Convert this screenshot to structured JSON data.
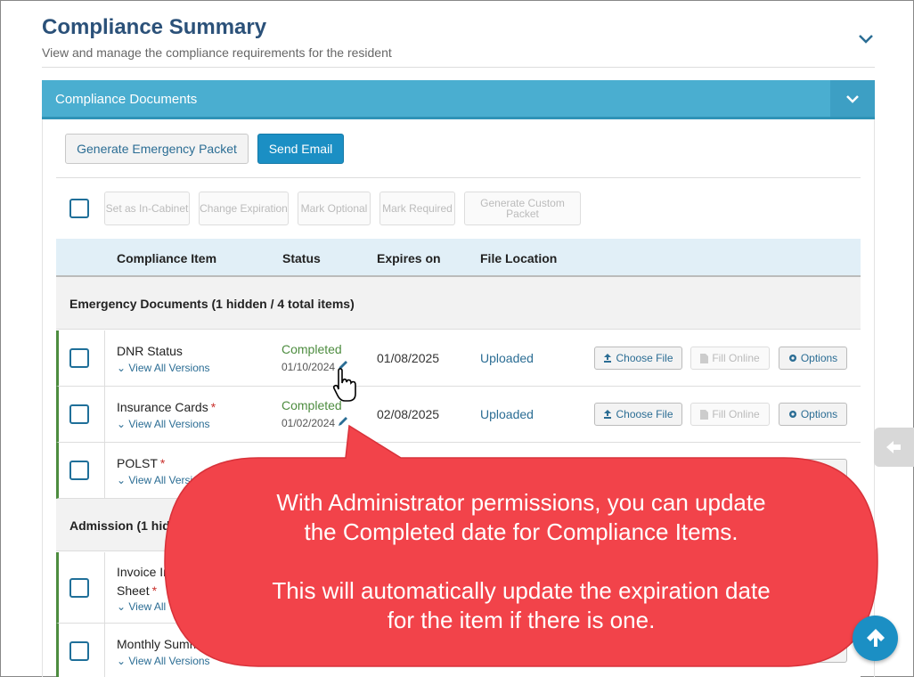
{
  "header": {
    "title": "Compliance Summary",
    "subtitle": "View and manage the compliance requirements for the resident"
  },
  "panel": {
    "title": "Compliance Documents"
  },
  "actions": {
    "generate_emergency_packet": "Generate Emergency Packet",
    "send_email": "Send Email"
  },
  "bulk_actions": {
    "set_in_cabinet": "Set as In-Cabinet",
    "change_expiration": "Change Expiration",
    "mark_optional": "Mark Optional",
    "mark_required": "Mark Required",
    "generate_custom_packet": "Generate Custom Packet"
  },
  "table": {
    "columns": [
      "Compliance Item",
      "Status",
      "Expires on",
      "File Location"
    ]
  },
  "groups": [
    {
      "label": "Emergency Documents (1 hidden / 4 total items)"
    },
    {
      "label": "Admission (1 hidden"
    }
  ],
  "rows": [
    {
      "name": "DNR Status",
      "required": "",
      "versions": "View All Versions",
      "status": "Completed",
      "status_date": "01/10/2024",
      "expires": "01/08/2025",
      "file_location": "Uploaded"
    },
    {
      "name": "Insurance Cards",
      "required": "*",
      "versions": "View All Versions",
      "status": "Completed",
      "status_date": "01/02/2024",
      "expires": "02/08/2025",
      "file_location": "Uploaded"
    },
    {
      "name": "POLST",
      "required": "*",
      "versions": "View All Versions"
    },
    {
      "name_line1": "Invoice In",
      "name_line2": "Sheet",
      "required": "*",
      "versions": "View All Versions"
    },
    {
      "name": "Monthly Summa",
      "versions": "View All Versions"
    }
  ],
  "row_buttons": {
    "choose_file": "Choose File",
    "fill_online": "Fill Online",
    "options": "Options",
    "options_partial": "tions"
  },
  "callout": {
    "line1": "With Administrator permissions, you can update",
    "line2": "the Completed date for Compliance Items.",
    "line3": "This will automatically update the expiration date",
    "line4": "for the item if there is one.",
    "color": "#f2434a"
  },
  "colors": {
    "brand_title": "#2b5179",
    "panel_header": "#4aaed0",
    "primary_button": "#1b8fc4",
    "completed": "#4d8c3f",
    "required": "#c9302c"
  },
  "icons": {
    "header_toggle": "chevron-down-icon",
    "upload": "upload-icon",
    "file": "file-icon",
    "gear": "gear-icon",
    "pencil": "pencil-icon",
    "back": "arrow-left-icon",
    "scroll_top": "arrow-up-icon",
    "cursor": "hand-pointer-icon"
  }
}
